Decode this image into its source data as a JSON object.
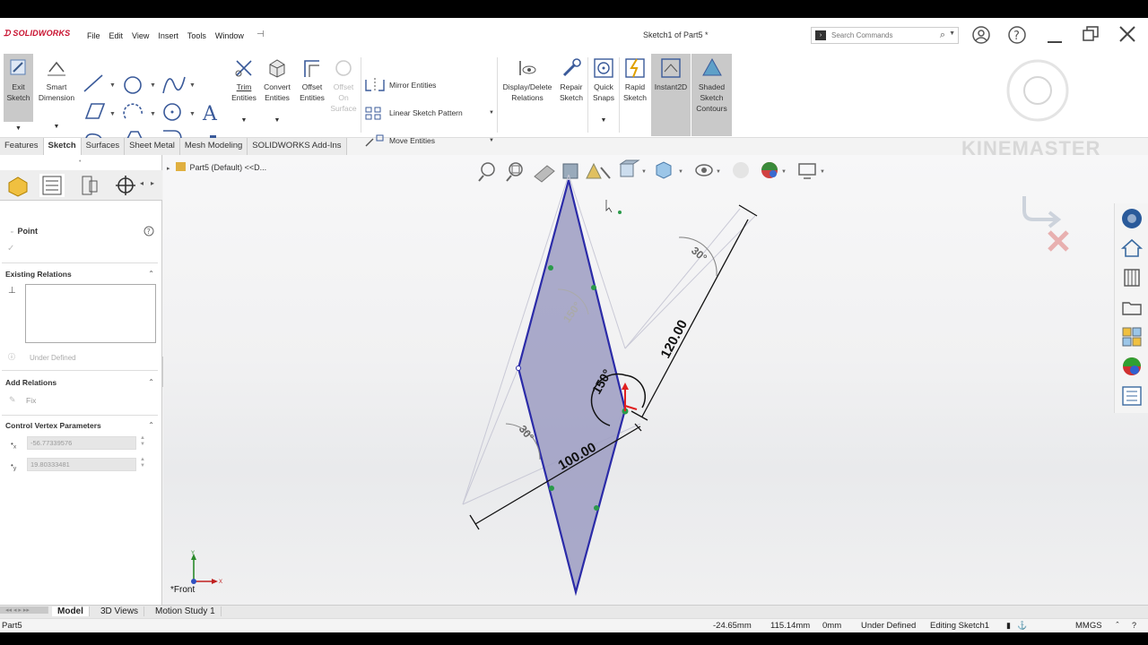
{
  "app": {
    "logo_text": "SOLIDWORKS",
    "doc_title": "Sketch1 of Part5 *",
    "pin_glyph": "⊣"
  },
  "menu": [
    "File",
    "Edit",
    "View",
    "Insert",
    "Tools",
    "Window"
  ],
  "search": {
    "placeholder": "Search Commands"
  },
  "commands": {
    "exit_sketch": [
      "Exit",
      "Sketch"
    ],
    "smart_dimension": [
      "Smart",
      "Dimension"
    ],
    "trim": [
      "Trim",
      "Entities"
    ],
    "convert": [
      "Convert",
      "Entities"
    ],
    "offset": [
      "Offset",
      "Entities"
    ],
    "offset_surface": [
      "Offset",
      "On",
      "Surface"
    ],
    "mirror": "Mirror Entities",
    "linear_pattern": "Linear Sketch Pattern",
    "move": "Move Entities",
    "display_delete": [
      "Display/Delete",
      "Relations"
    ],
    "repair": [
      "Repair",
      "Sketch"
    ],
    "quick_snaps": [
      "Quick",
      "Snaps"
    ],
    "rapid_sketch": [
      "Rapid",
      "Sketch"
    ],
    "instant2d": "Instant2D",
    "shaded": [
      "Shaded",
      "Sketch",
      "Contours"
    ]
  },
  "tabs": [
    "Features",
    "Sketch",
    "Surfaces",
    "Sheet Metal",
    "Mesh Modeling",
    "SOLIDWORKS Add-Ins"
  ],
  "active_tab": "Sketch",
  "panel": {
    "title": "Point",
    "existing_relations": "Existing Relations",
    "status": "Under Defined",
    "add_relations": "Add Relations",
    "fix": "Fix",
    "params_title": "Control Vertex Parameters",
    "x_value": "-56.77339576",
    "y_value": "19.80333481"
  },
  "tree": {
    "label": "Part5 (Default) <<D..."
  },
  "view_label": "*Front",
  "sketch": {
    "dim_length_1": "120.00",
    "dim_length_2": "100.00",
    "angle_main": "150°",
    "angle_top": "30°",
    "angle_left": "30°",
    "angle_inner": "150°"
  },
  "bottom_tabs": [
    "Model",
    "3D Views",
    "Motion Study 1"
  ],
  "status": {
    "part": "Part5",
    "x": "-24.65mm",
    "y": "115.14mm",
    "z": "0mm",
    "state": "Under Defined",
    "mode": "Editing Sketch1",
    "units": "MMGS"
  },
  "watermark": "KINEMASTER",
  "colors": {
    "accent": "#c8102e",
    "sketch_line": "#2b2ba8",
    "fill": "#9c9cc2"
  }
}
